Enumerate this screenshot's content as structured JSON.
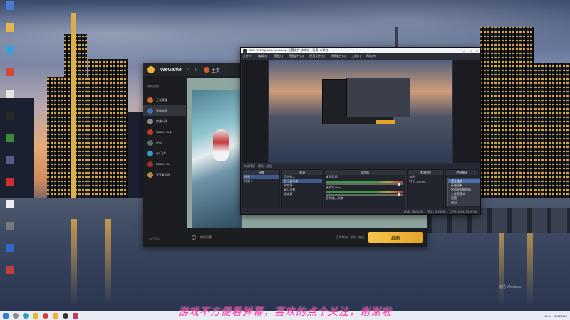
{
  "wegame": {
    "title": "WeGame",
    "tab_label": "主页",
    "side_header": "我的游戏",
    "games": [
      {
        "label": "王者荣耀",
        "color": "#d06a2a"
      },
      {
        "label": "英雄联盟",
        "color": "#3f6fb0"
      },
      {
        "label": "穿越火线",
        "color": "#8a8a8a"
      },
      {
        "label": "NBA2K OL2",
        "color": "#c23a2a"
      },
      {
        "label": "逆战",
        "color": "#5a6a7a"
      },
      {
        "label": "QQ飞车",
        "color": "#3a9ad0"
      },
      {
        "label": "NBA2K OL",
        "color": "#a03030"
      },
      {
        "label": "天天爱消除",
        "color": "#b38a3a"
      }
    ],
    "side_footer": "自行添加",
    "settings_label": "辅助设置",
    "status_text": "正常状态 · 版本 · 在线",
    "start_button": "启动"
  },
  "obs": {
    "title": "OBS 27.1.3 (64-bit, windows) - 配置文件: 未命名 - 场景: 未命名",
    "window_controls": [
      "—",
      "□",
      "✕"
    ],
    "menu": [
      "文件(F)",
      "编辑(E)",
      "视图(V)",
      "停靠部件(D)",
      "配置文件(P)",
      "场景集合(S)",
      "工具(T)",
      "帮助(H)"
    ],
    "stats_bar": [
      "未选择源",
      "属性",
      "滤镜"
    ],
    "docks": {
      "scenes": {
        "header": "场景",
        "items": [
          "场景",
          "场景 2"
        ]
      },
      "sources": {
        "header": "来源",
        "items": [
          "音频输入",
          "显示器采集",
          "游戏源",
          "窗口采集",
          "媒体源"
        ]
      },
      "mixer": {
        "header": "混音器",
        "channels": [
          "桌面音频",
          "麦克风/Aux",
          "音频输入采集"
        ]
      },
      "transitions": {
        "header": "转场特效",
        "mode": "淡出",
        "duration_label": "时长",
        "duration": "300 ms"
      },
      "controls": {
        "header": "控制按钮"
      }
    },
    "context_menu": [
      "停止推流",
      "开始录制",
      "启动虚拟摄像机",
      "工作室模式",
      "设置",
      "退出"
    ],
    "footer": [
      "LIVE: 00:00:00",
      "REC: 00:00:00",
      "CPU: 3.2%, 30.00 fps"
    ]
  },
  "taskbar": {
    "time": "19:34",
    "date": "2022/8/24"
  },
  "caption": "游戏不方便看弹幕，喜欢的点个关注，谢谢啦",
  "watermark": "激活 Windows"
}
